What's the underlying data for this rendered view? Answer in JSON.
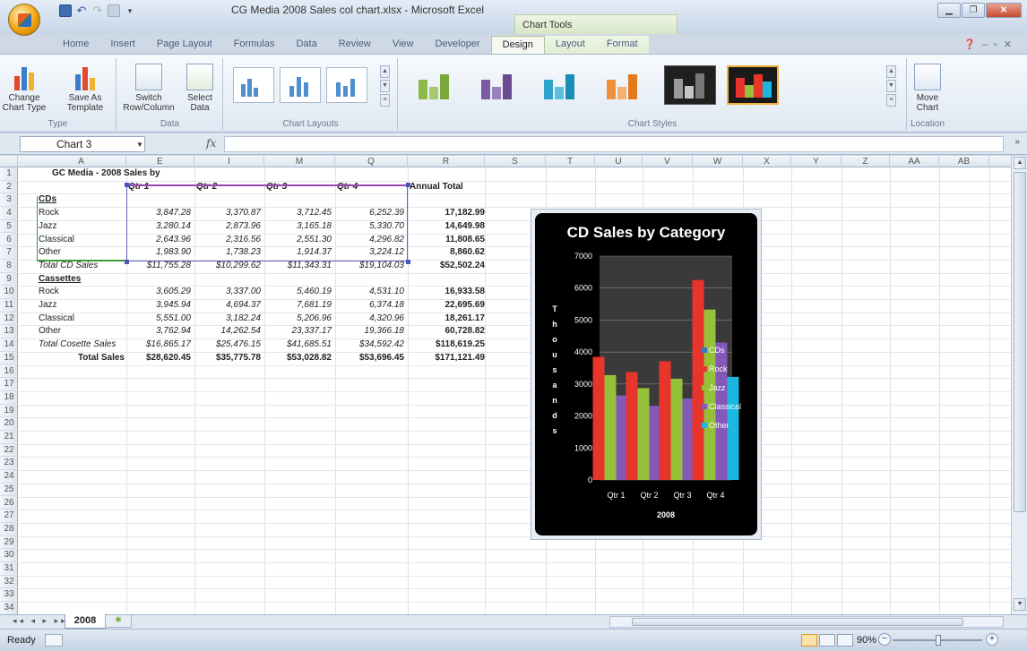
{
  "window": {
    "title": "CG Media 2008 Sales col chart.xlsx - Microsoft Excel",
    "chart_tools": "Chart Tools"
  },
  "qat": {
    "dropdown": "▾"
  },
  "tabs": [
    "Home",
    "Insert",
    "Page Layout",
    "Formulas",
    "Data",
    "Review",
    "View",
    "Developer",
    "Design",
    "Layout",
    "Format"
  ],
  "ribbon": {
    "change_chart_type": "Change Chart Type",
    "save_as_template": "Save As Template",
    "group_type": "Type",
    "switch_row_column": "Switch Row/Column",
    "select_data": "Select Data",
    "group_data": "Data",
    "group_chart_layouts": "Chart Layouts",
    "group_chart_styles": "Chart Styles",
    "move_chart": "Move Chart",
    "group_location": "Location"
  },
  "formula_bar": {
    "name_box": "Chart 3",
    "fx": "fx"
  },
  "columns": [
    "A",
    "E",
    "I",
    "M",
    "Q",
    "R",
    "S",
    "T",
    "U",
    "V",
    "W",
    "X",
    "Y",
    "Z",
    "AA",
    "AB"
  ],
  "rows": [
    "1",
    "2",
    "3",
    "4",
    "5",
    "6",
    "7",
    "8",
    "9",
    "10",
    "11",
    "12",
    "13",
    "14",
    "15",
    "16",
    "17",
    "18",
    "19",
    "20",
    "21",
    "22",
    "23",
    "24",
    "25",
    "26",
    "27",
    "28",
    "29",
    "30",
    "31",
    "32",
    "33",
    "34"
  ],
  "cells": {
    "title": "GC Media -  2008 Sales by",
    "h_q1": "Qtr 1",
    "h_q2": "Qtr 2",
    "h_q3": "Qtr 3",
    "h_q4": "Qtr 4",
    "h_annual": "Annual Total",
    "cds": "CDs",
    "cassettes": "Cassettes",
    "cd_rows": [
      {
        "label": "Rock",
        "q1": "3,847.28",
        "q2": "3,370.87",
        "q3": "3,712.45",
        "q4": "6,252.39",
        "total": "17,182.99"
      },
      {
        "label": "Jazz",
        "q1": "3,280.14",
        "q2": "2,873.96",
        "q3": "3,165.18",
        "q4": "5,330.70",
        "total": "14,649.98"
      },
      {
        "label": "Classical",
        "q1": "2,643.96",
        "q2": "2,316.56",
        "q3": "2,551.30",
        "q4": "4,296.82",
        "total": "11,808.65"
      },
      {
        "label": "Other",
        "q1": "1,983.90",
        "q2": "1,738.23",
        "q3": "1,914.37",
        "q4": "3,224.12",
        "total": "8,860.62"
      }
    ],
    "cd_total": {
      "label": "Total CD Sales",
      "q1": "$11,755.28",
      "q2": "$10,299.62",
      "q3": "$11,343.31",
      "q4": "$19,104.03",
      "total": "$52,502.24"
    },
    "cas_rows": [
      {
        "label": "Rock",
        "q1": "3,605.29",
        "q2": "3,337.00",
        "q3": "5,460.19",
        "q4": "4,531.10",
        "total": "16,933.58"
      },
      {
        "label": "Jazz",
        "q1": "3,945.94",
        "q2": "4,694.37",
        "q3": "7,681.19",
        "q4": "6,374.18",
        "total": "22,695.69"
      },
      {
        "label": "Classical",
        "q1": "5,551.00",
        "q2": "3,182.24",
        "q3": "5,206.96",
        "q4": "4,320.96",
        "total": "18,261.17"
      },
      {
        "label": "Other",
        "q1": "3,762.94",
        "q2": "14,262.54",
        "q3": "23,337.17",
        "q4": "19,366.18",
        "total": "60,728.82"
      }
    ],
    "cas_total": {
      "label": "Total Cosette Sales",
      "q1": "$16,865.17",
      "q2": "$25,476.15",
      "q3": "$41,685.51",
      "q4": "$34,592.42",
      "total": "$118,619.25"
    },
    "grand_total": {
      "label": "Total Sales",
      "q1": "$28,620.45",
      "q2": "$35,775.78",
      "q3": "$53,028.82",
      "q4": "$53,696.45",
      "total": "$171,121.49"
    }
  },
  "sheet_tab": "2008",
  "status": {
    "ready": "Ready",
    "zoom": "90%"
  },
  "colors": {
    "rock": "#e8352b",
    "jazz": "#94c03a",
    "classical": "#8457b8",
    "other": "#1ab8e0",
    "cds": "#2f79c4"
  },
  "chart_data": {
    "type": "bar",
    "title": "CD Sales by Category",
    "xlabel": "2008",
    "ylabel": "Thousands",
    "categories": [
      "Qtr 1",
      "Qtr 2",
      "Qtr 3",
      "Qtr 4"
    ],
    "ylim": [
      0,
      7000
    ],
    "yticks": [
      "0",
      "1000",
      "2000",
      "3000",
      "4000",
      "5000",
      "6000",
      "7000"
    ],
    "grid": true,
    "legend_position": "right",
    "series": [
      {
        "name": "CDs",
        "values": [
          null,
          null,
          null,
          null
        ]
      },
      {
        "name": "Rock",
        "values": [
          3847.28,
          3370.87,
          3712.45,
          6252.39
        ]
      },
      {
        "name": "Jazz",
        "values": [
          3280.14,
          2873.96,
          3165.18,
          5330.7
        ]
      },
      {
        "name": "Classical",
        "values": [
          2643.96,
          2316.56,
          2551.3,
          4296.82
        ]
      },
      {
        "name": "Other",
        "values": [
          1983.9,
          1738.23,
          1914.37,
          3224.12
        ]
      }
    ]
  }
}
